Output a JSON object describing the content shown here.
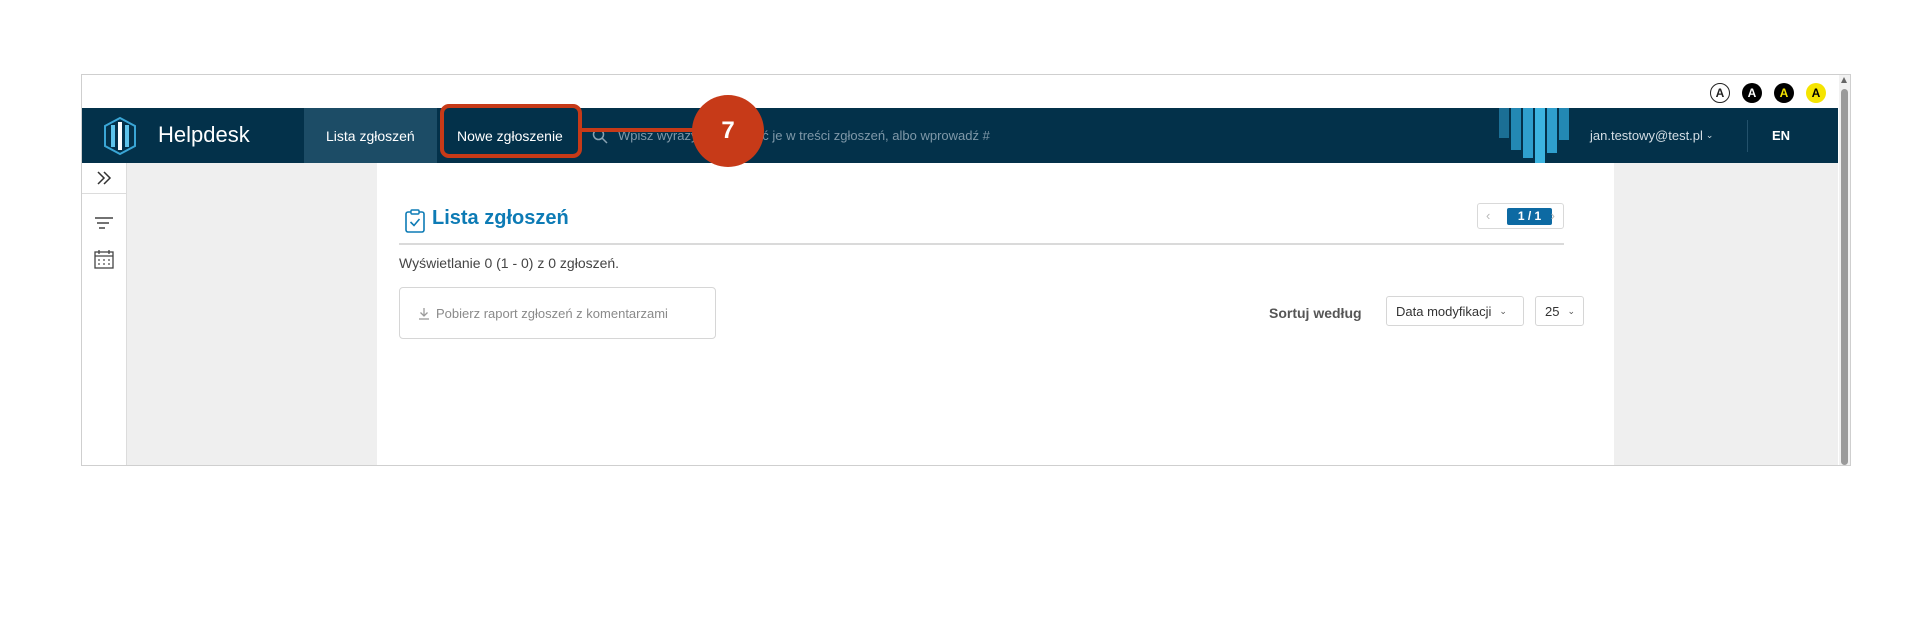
{
  "accessibility": {
    "contrast_labels": [
      "A",
      "A",
      "A",
      "A"
    ]
  },
  "header": {
    "app_title": "Helpdesk",
    "tabs": [
      {
        "label": "Lista zgłoszeń",
        "active": true
      },
      {
        "label": "Nowe zgłoszenie",
        "active": false
      }
    ],
    "search_placeholder": "Wpisz wyrazy, aby szukać je w treści zgłoszeń, albo wprowadź #",
    "user_email": "jan.testowy@test.pl",
    "language": "EN"
  },
  "main": {
    "title": "Lista zgłoszeń",
    "pager": {
      "prev": "‹",
      "current": "1 / 1",
      "next": "›"
    },
    "summary": "Wyświetlanie 0 (1 - 0) z 0 zgłoszeń.",
    "report_button": "Pobierz raport zgłoszeń z komentarzami",
    "sort_label": "Sortuj według",
    "sort_value": "Data modyfikacji",
    "per_page_value": "25"
  },
  "annotation": {
    "step_number": "7"
  },
  "colors": {
    "nav_background": "#03314a",
    "nav_active_tab": "#1c4c66",
    "accent": "#0d7bb5",
    "highlight": "#c73a18"
  }
}
